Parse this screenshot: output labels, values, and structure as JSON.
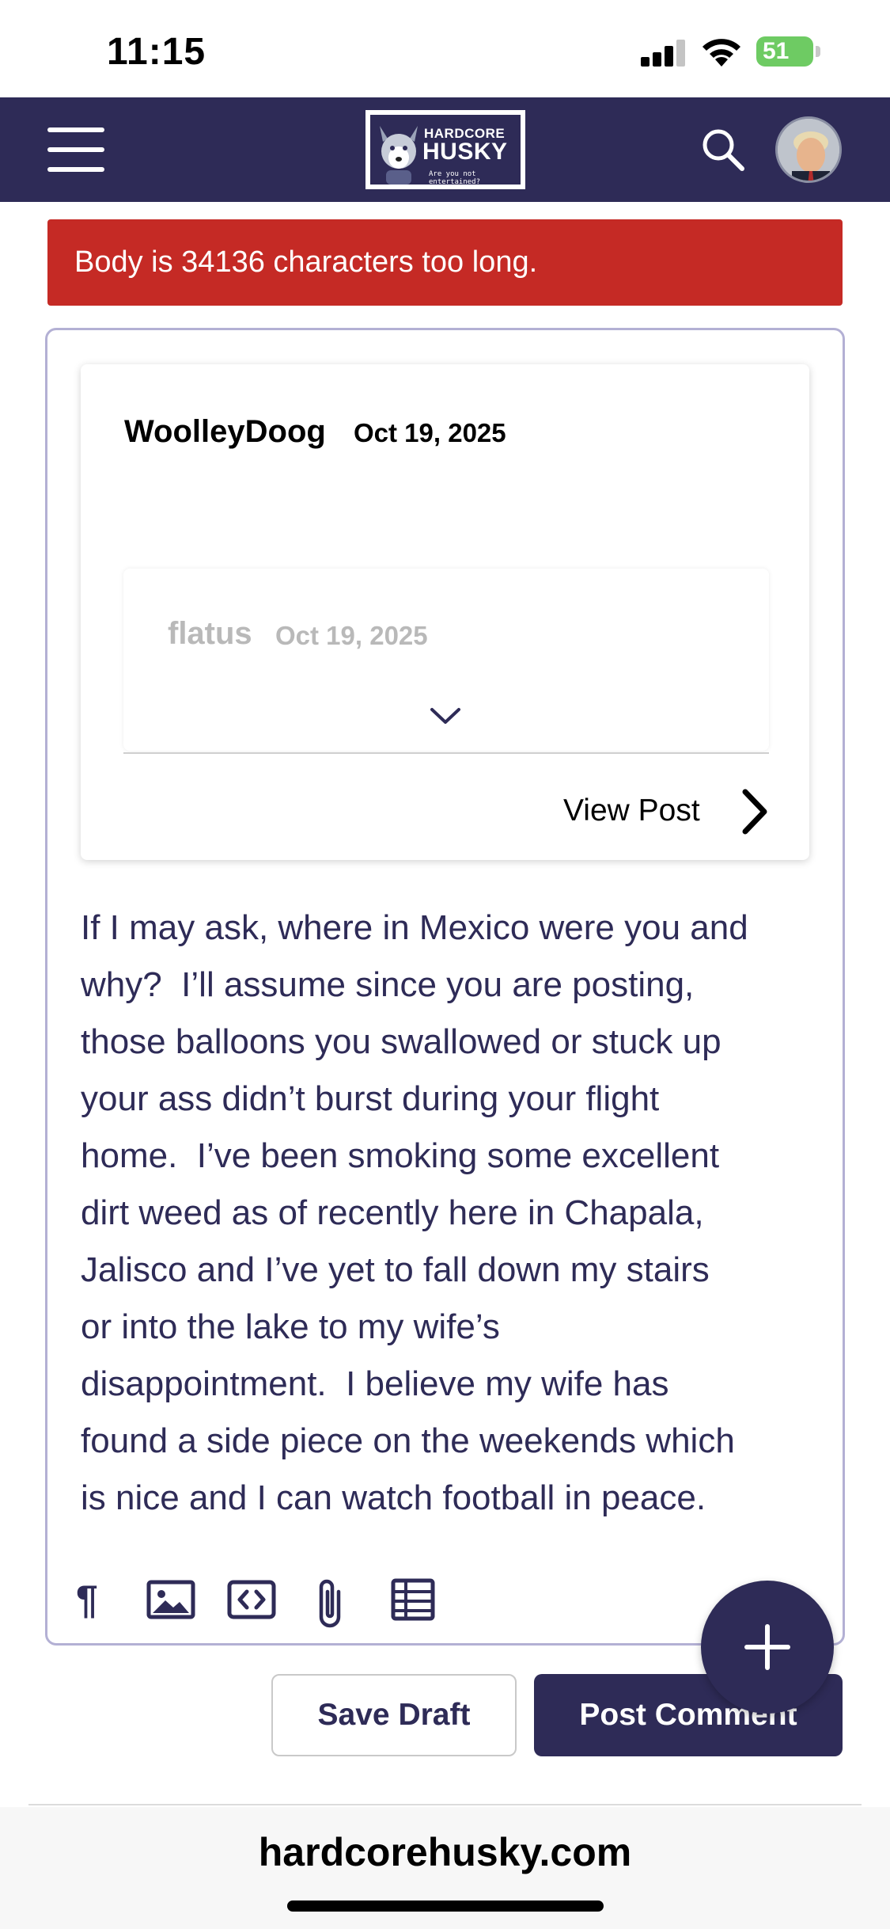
{
  "status_bar": {
    "time": "11:15",
    "battery": "51"
  },
  "header": {
    "logo_line1": "HARDCORE",
    "logo_line2": "HUSKY",
    "logo_tagline": "Are you not entertained?"
  },
  "error": {
    "message": "Body is 34136 characters too long."
  },
  "quote": {
    "author": "WoolleyDoog",
    "date": "Oct 19, 2025",
    "nested": {
      "author": "flatus",
      "date": "Oct 19, 2025"
    },
    "view_post_label": "View Post"
  },
  "comment": {
    "body": "If I may ask, where in Mexico were you and\nwhy?  I’ll assume since you are posting,\nthose balloons you swallowed or stuck up\nyour ass didn’t burst during your flight\nhome.  I’ve been smoking some excellent\ndirt weed as of recently here in Chapala,\nJalisco and I’ve yet to fall down my stairs\nor into the lake to my wife’s\ndisappointment.  I believe my wife has\nfound a side piece on the weekends which\nis nice and I can watch football in peace."
  },
  "toolbar": {
    "items": [
      "paragraph-icon",
      "image-icon",
      "code-icon",
      "attachment-icon",
      "table-icon"
    ]
  },
  "actions": {
    "save_draft": "Save Draft",
    "post_comment": "Post Comment"
  },
  "browser": {
    "url": "hardcorehusky.com"
  },
  "colors": {
    "brand": "#2e2b57",
    "error": "#c52a25"
  }
}
